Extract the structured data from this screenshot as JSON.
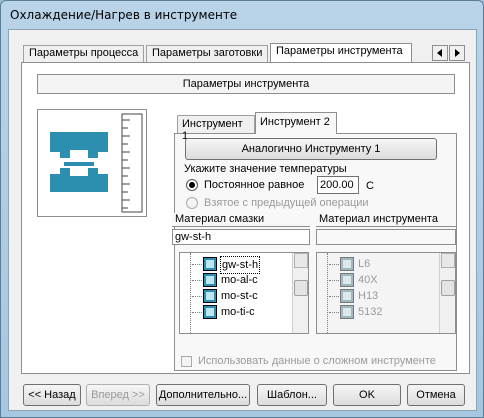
{
  "window": {
    "title": "Охлаждение/Нагрев в инструменте"
  },
  "tabs": [
    {
      "label": "Параметры процесса"
    },
    {
      "label": "Параметры заготовки"
    },
    {
      "label": "Параметры инструмента",
      "active": true
    }
  ],
  "section_title": "Параметры инструмента",
  "tool_tabs": [
    {
      "label": "Инструмент 1"
    },
    {
      "label": "Инструмент 2",
      "active": true
    }
  ],
  "same_as_button": "Аналогично Инструменту 1",
  "temperature": {
    "label": "Укажите значение температуры",
    "constant_label": "Постоянное равное",
    "value": "200.00",
    "unit": "C",
    "from_previous_label": "Взятое с предыдущей операции"
  },
  "lubricant": {
    "label": "Материал смазки",
    "selected": "gw-st-h",
    "items": [
      "gw-st-h",
      "mo-al-c",
      "mo-st-c",
      "mo-ti-c"
    ]
  },
  "tool_material": {
    "label": "Материал инструмента",
    "items": [
      "L6",
      "40X",
      "H13",
      "5132"
    ]
  },
  "complex_tool_checkbox": "Использовать данные о сложном инструменте",
  "buttons": {
    "back": "<< Назад",
    "next": "Вперед >>",
    "more": "Дополнительно...",
    "template": "Шаблон...",
    "ok": "OK",
    "cancel": "Отмена"
  },
  "colors": {
    "tool_icon": "#2c8fb0",
    "selection": "#3399ff"
  }
}
